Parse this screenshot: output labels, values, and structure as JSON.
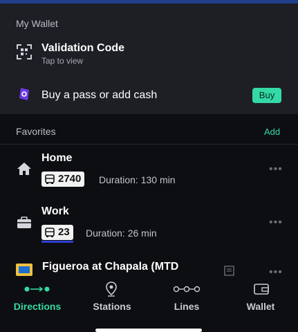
{
  "wallet": {
    "section_label": "My Wallet",
    "validation": {
      "title": "Validation Code",
      "subtitle": "Tap to view"
    },
    "buy_pass": {
      "title": "Buy a pass or add cash",
      "button_label": "Buy"
    }
  },
  "favorites": {
    "section_label": "Favorites",
    "add_label": "Add",
    "items": [
      {
        "name": "Home",
        "route": "2740",
        "duration": "Duration: 130 min"
      },
      {
        "name": "Work",
        "route": "23",
        "duration": "Duration: 26 min"
      },
      {
        "name": "Figueroa at Chapala (MTD"
      }
    ]
  },
  "tabs": [
    {
      "label": "Directions",
      "icon": "directions-icon",
      "active": true
    },
    {
      "label": "Stations",
      "icon": "location-pin-icon",
      "active": false
    },
    {
      "label": "Lines",
      "icon": "lines-icon",
      "active": false
    },
    {
      "label": "Wallet",
      "icon": "wallet-icon",
      "active": false
    }
  ],
  "colors": {
    "accent": "#34d9a5",
    "route_underline": "#2f3fd6",
    "background": "#0d0e11",
    "panel": "#1d1f24"
  }
}
